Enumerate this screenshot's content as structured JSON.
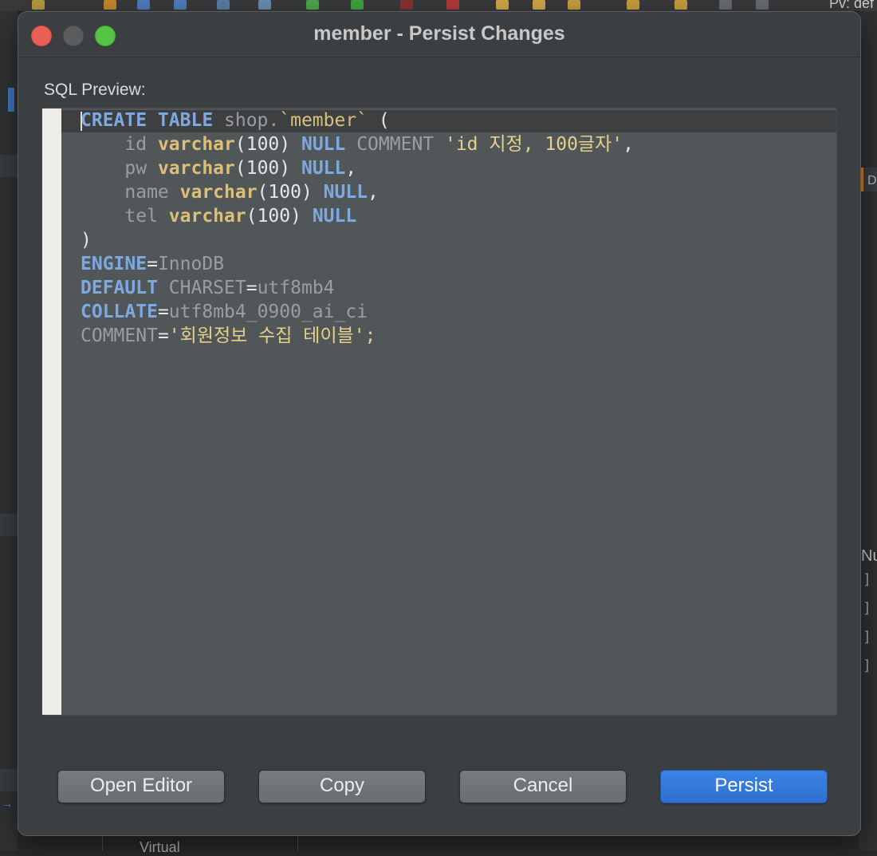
{
  "window": {
    "title": "member - Persist Changes"
  },
  "preview": {
    "label": "SQL Preview:",
    "lines": [
      [
        {
          "t": "CREATE TABLE",
          "c": "kw"
        },
        {
          "t": " shop.",
          "c": "dim"
        },
        {
          "t": "`member`",
          "c": "bq"
        },
        {
          "t": " (",
          "c": "num"
        }
      ],
      [
        {
          "t": "    id ",
          "c": "dim"
        },
        {
          "t": "varchar",
          "c": "ty"
        },
        {
          "t": "(100) ",
          "c": "num"
        },
        {
          "t": "NULL",
          "c": "kw"
        },
        {
          "t": " COMMENT ",
          "c": "dim"
        },
        {
          "t": "'id 지정, 100글자'",
          "c": "str"
        },
        {
          "t": ",",
          "c": "num"
        }
      ],
      [
        {
          "t": "    pw ",
          "c": "dim"
        },
        {
          "t": "varchar",
          "c": "ty"
        },
        {
          "t": "(100) ",
          "c": "num"
        },
        {
          "t": "NULL",
          "c": "kw"
        },
        {
          "t": ",",
          "c": "num"
        }
      ],
      [
        {
          "t": "    name ",
          "c": "dim"
        },
        {
          "t": "varchar",
          "c": "ty"
        },
        {
          "t": "(100) ",
          "c": "num"
        },
        {
          "t": "NULL",
          "c": "kw"
        },
        {
          "t": ",",
          "c": "num"
        }
      ],
      [
        {
          "t": "    tel ",
          "c": "dim"
        },
        {
          "t": "varchar",
          "c": "ty"
        },
        {
          "t": "(100) ",
          "c": "num"
        },
        {
          "t": "NULL",
          "c": "kw"
        }
      ],
      [
        {
          "t": ")",
          "c": "num"
        }
      ],
      [
        {
          "t": "ENGINE",
          "c": "kw"
        },
        {
          "t": "=",
          "c": "num"
        },
        {
          "t": "InnoDB",
          "c": "dim"
        }
      ],
      [
        {
          "t": "DEFAULT",
          "c": "kw"
        },
        {
          "t": " CHARSET",
          "c": "dim"
        },
        {
          "t": "=",
          "c": "num"
        },
        {
          "t": "utf8mb4",
          "c": "dim"
        }
      ],
      [
        {
          "t": "COLLATE",
          "c": "kw"
        },
        {
          "t": "=",
          "c": "num"
        },
        {
          "t": "utf8mb4_0900_ai_ci",
          "c": "dim"
        }
      ],
      [
        {
          "t": "COMMENT",
          "c": "dim"
        },
        {
          "t": "=",
          "c": "num"
        },
        {
          "t": "'회원정보 수집 테이블'",
          "c": "str"
        },
        {
          "t": ";",
          "c": "str"
        }
      ]
    ]
  },
  "buttons": {
    "open_editor": "Open Editor",
    "copy": "Copy",
    "cancel": "Cancel",
    "persist": "Persist"
  },
  "background": {
    "top_right_text": "Pv: def",
    "right_panel_letter": "D",
    "right_panel_text": "Nu",
    "bottom_text": "Virtual",
    "brackets": [
      "]",
      "]",
      "]",
      "]"
    ]
  },
  "colors": {
    "keyword": "#7ea8e0",
    "type": "#dcc077",
    "string": "#e6cf8b",
    "primary_button": "#2d6fd0",
    "close_light": "#ec5f57",
    "zoom_light": "#56c447"
  }
}
